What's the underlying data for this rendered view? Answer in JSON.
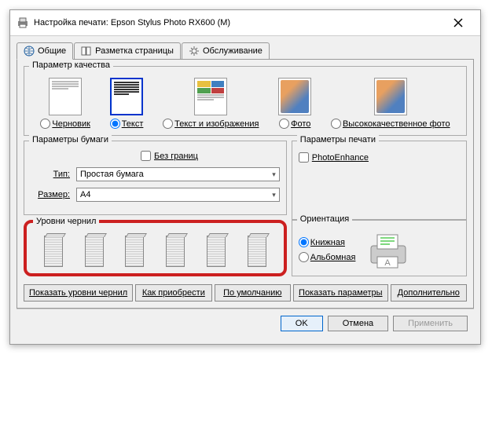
{
  "window": {
    "title": "Настройка печати: Epson Stylus Photo RX600 (M)"
  },
  "tabs": {
    "general": "Общие",
    "layout": "Разметка страницы",
    "maintenance": "Обслуживание"
  },
  "quality": {
    "group_title": "Параметр качества",
    "draft": "Черновик",
    "text": "Текст",
    "text_image": "Текст и изображения",
    "photo": "Фото",
    "best_photo": "Высококачественное фото"
  },
  "paper": {
    "group_title": "Параметры бумаги",
    "borderless": "Без границ",
    "type_label": "Тип:",
    "type_value": "Простая бумага",
    "size_label": "Размер:",
    "size_value": "A4"
  },
  "print_options": {
    "group_title": "Параметры печати",
    "photo_enhance": "PhotoEnhance"
  },
  "ink": {
    "group_title": "Уровни чернил"
  },
  "orientation": {
    "group_title": "Ориентация",
    "portrait": "Книжная",
    "landscape": "Альбомная"
  },
  "buttons": {
    "show_ink": "Показать уровни чернил",
    "how_buy": "Как приобрести",
    "defaults": "По умолчанию",
    "show_params": "Показать параметры",
    "advanced": "Дополнительно"
  },
  "dialog": {
    "ok": "OK",
    "cancel": "Отмена",
    "apply": "Применить"
  }
}
